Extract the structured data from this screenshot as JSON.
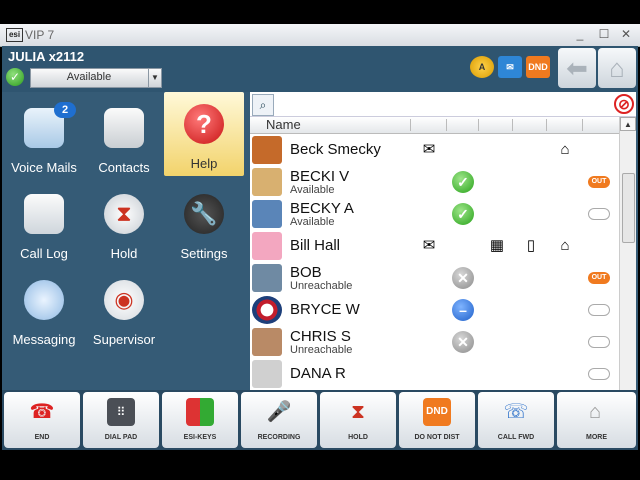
{
  "window": {
    "title": "VIP 7",
    "logo": "esi-logo-icon",
    "controls": [
      "_",
      "☐",
      "✕"
    ]
  },
  "user": {
    "name": "JULIA x2112",
    "status": "Available"
  },
  "header_icons": [
    "attendant-icon",
    "mail-icon",
    "dnd-badge-icon"
  ],
  "dnd_label": "DND",
  "nav": {
    "back": "back-arrow-icon",
    "home": "home-icon"
  },
  "grid": [
    {
      "label": "Voice Mails",
      "badge": "2"
    },
    {
      "label": "Contacts"
    },
    {
      "label": "Help"
    },
    {
      "label": "Call Log"
    },
    {
      "label": "Hold"
    },
    {
      "label": "Settings"
    },
    {
      "label": "Messaging"
    },
    {
      "label": "Supervisor"
    }
  ],
  "list": {
    "column_header": "Name",
    "search_placeholder": "",
    "rows": [
      {
        "name": "Beck Smecky",
        "status": ""
      },
      {
        "name": "BECKI V",
        "status": "Available",
        "badge": "OUT"
      },
      {
        "name": "BECKY A",
        "status": "Available"
      },
      {
        "name": "Bill Hall",
        "status": ""
      },
      {
        "name": "BOB",
        "status": "Unreachable",
        "badge": "OUT"
      },
      {
        "name": "BRYCE W",
        "status": ""
      },
      {
        "name": "CHRIS S",
        "status": "Unreachable"
      },
      {
        "name": "DANA R",
        "status": ""
      }
    ]
  },
  "toolbar": [
    {
      "label": "END"
    },
    {
      "label": "DIAL PAD"
    },
    {
      "label": "ESI-KEYS"
    },
    {
      "label": "RECORDING"
    },
    {
      "label": "HOLD"
    },
    {
      "label": "DO NOT DIST",
      "icon_text": "DND"
    },
    {
      "label": "CALL FWD"
    },
    {
      "label": "MORE"
    }
  ],
  "colors": {
    "panel": "#355b76",
    "accent_orange": "#f07a1f",
    "ok_green": "#28a31a"
  }
}
